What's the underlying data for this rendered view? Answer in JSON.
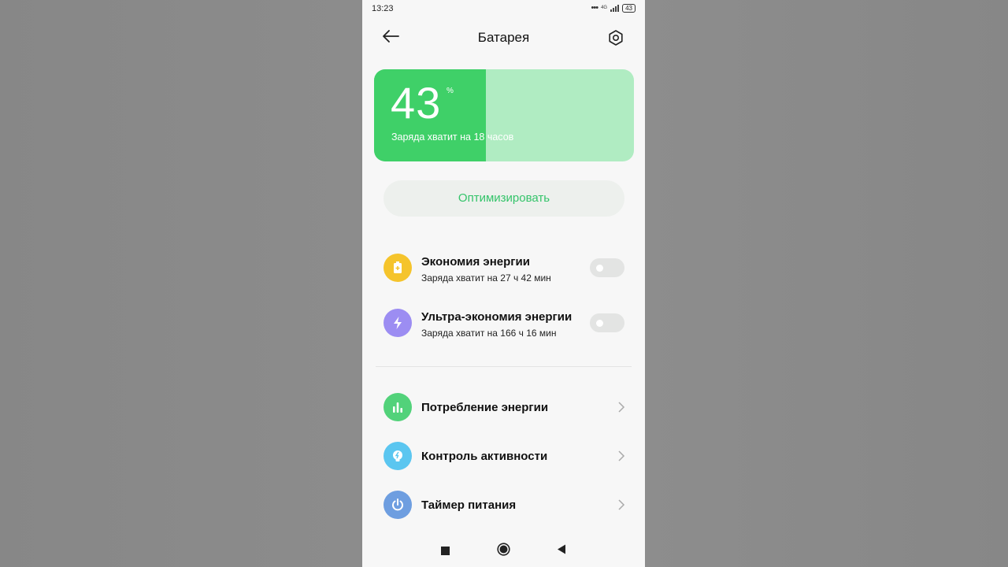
{
  "status": {
    "time": "13:23",
    "network": "4G",
    "battery": "43"
  },
  "header": {
    "title": "Батарея",
    "back_icon": "arrow-left-icon",
    "settings_icon": "gear-icon"
  },
  "battery": {
    "percent": "43",
    "percent_sign": "%",
    "level": 0.43,
    "note": "Заряда хватит на 18 часов",
    "fill_color": "#3fd068",
    "track_color": "#b0ecc2"
  },
  "optimize": {
    "label": "Оптимизировать",
    "color": "#34c46a"
  },
  "modes": [
    {
      "title": "Экономия энергии",
      "subtitle": "Заряда хватит на 27 ч 42 мин",
      "icon": "battery-plus-icon",
      "color": "#f5c42c",
      "enabled": false
    },
    {
      "title": "Ультра-экономия энергии",
      "subtitle": "Заряда хватит на 166 ч 16 мин",
      "icon": "lightning-icon",
      "color": "#9c8df2",
      "enabled": false
    }
  ],
  "menu": [
    {
      "title": "Потребление энергии",
      "icon": "bar-chart-icon",
      "color": "#52d27a"
    },
    {
      "title": "Контроль активности",
      "icon": "bulb-icon",
      "color": "#5bc6f0"
    },
    {
      "title": "Таймер питания",
      "icon": "power-icon",
      "color": "#6e9ee0"
    }
  ],
  "navbar": {
    "icons": [
      "recents-square-icon",
      "home-circle-icon",
      "back-triangle-icon"
    ]
  }
}
